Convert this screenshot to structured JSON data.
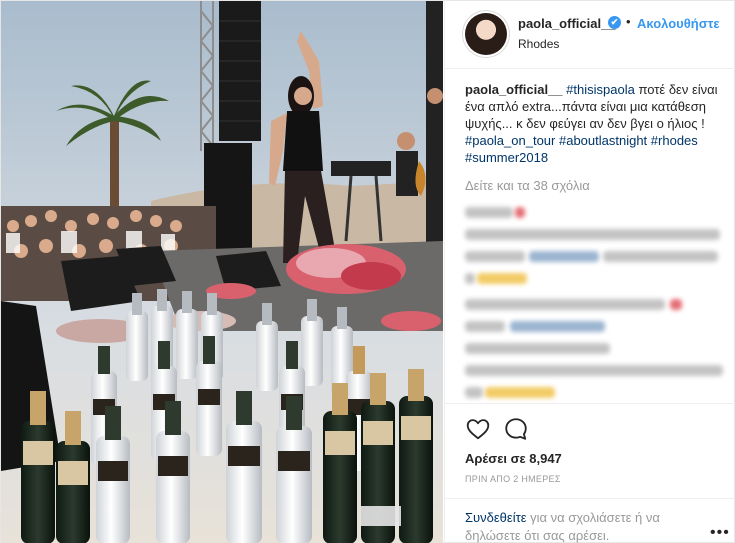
{
  "profile": {
    "username": "paola_official__",
    "verified_icon": "✔",
    "separator": "•",
    "follow_label": "Ακολουθήστε",
    "location": "Rhodes"
  },
  "caption": {
    "username": "paola_official__",
    "tag1": "#thisispaola",
    "text1": " ποτέ δεν είναι ένα απλό extra...πάντα είναι μια κατάθεση ψυχής... κ δεν φεύγει αν δεν βγει ο ήλιος ! ",
    "tag2": "#paola_on_tour",
    "tag3": "#aboutlastnight",
    "tag4": "#rhodes",
    "tag5": "#summer2018"
  },
  "view_all_comments": "Δείτε και τα 38 σχόλια",
  "likes": "Αρέσει σε 8,947",
  "time_ago": "ΠΡΙΝ ΑΠΟ 2 ΗΜΕΡΕΣ",
  "login": {
    "link_label": "Συνδεθείτε",
    "rest": " για να σχολιάσετε ή να δηλώσετε ότι σας αρέσει."
  },
  "more_label": "•••",
  "icons": {
    "like": "heart-icon",
    "comment": "comment-bubble-icon",
    "verified": "verified-badge-icon"
  },
  "colors": {
    "link_blue": "#3897f0",
    "hashtag": "#003569",
    "muted": "#999999",
    "text": "#262626"
  }
}
